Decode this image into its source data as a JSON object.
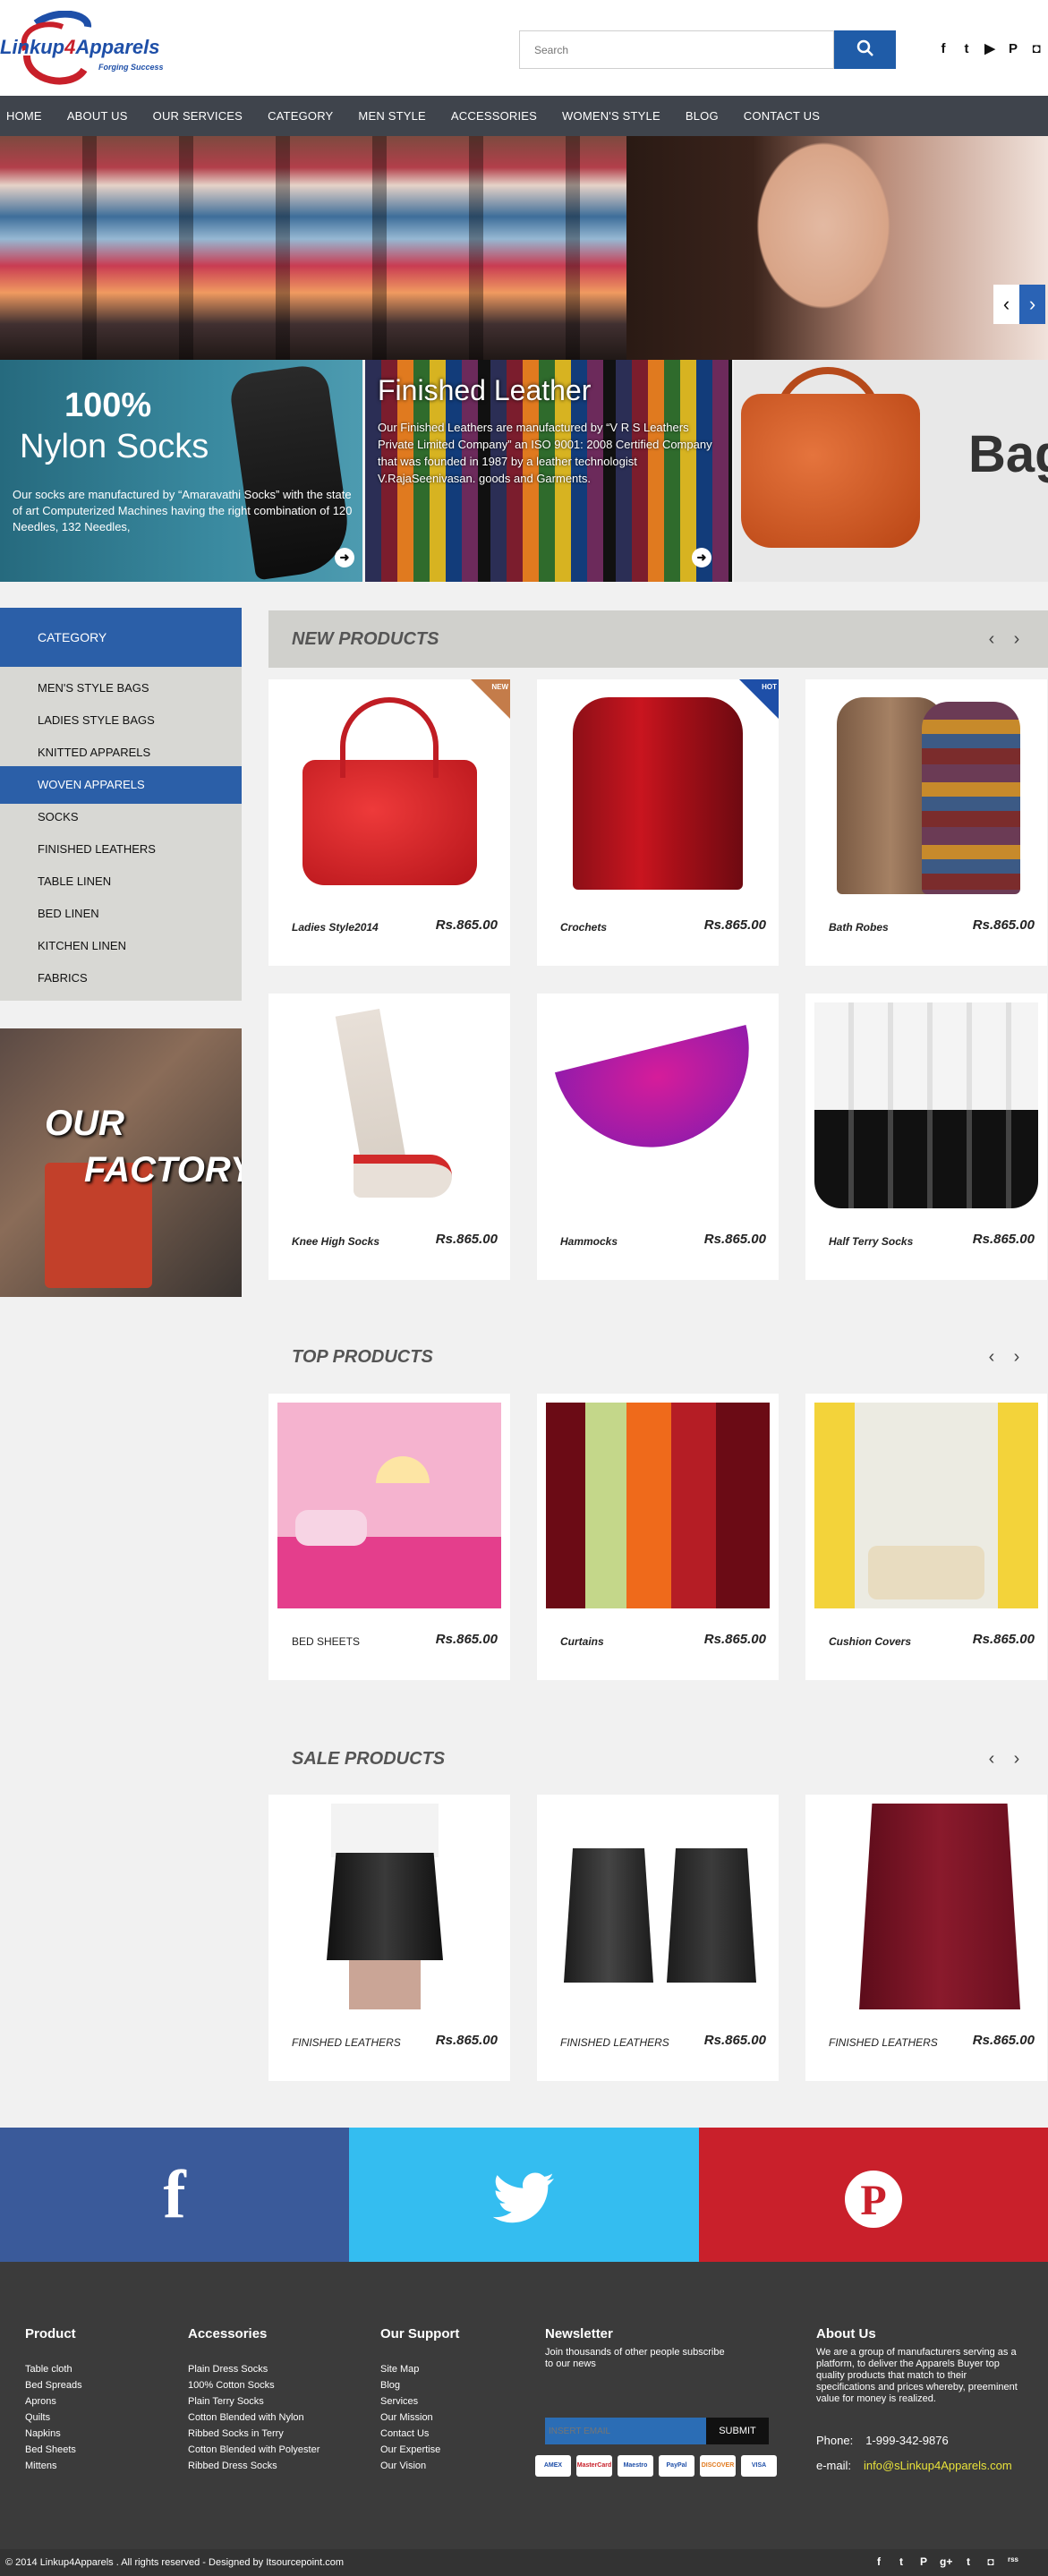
{
  "logo": {
    "name_part1": "Linkup",
    "name_part2": "4",
    "name_part3": "Apparels",
    "tagline": "Forging Success"
  },
  "search": {
    "placeholder": "Search"
  },
  "social_top": [
    {
      "icon": "facebook-icon",
      "glyph": "f"
    },
    {
      "icon": "twitter-icon",
      "glyph": "t"
    },
    {
      "icon": "youtube-icon",
      "glyph": "▶"
    },
    {
      "icon": "pinterest-icon",
      "glyph": "P"
    },
    {
      "icon": "instagram-icon",
      "glyph": "◘"
    }
  ],
  "nav": [
    "HOME",
    "ABOUT US",
    "OUR SERVICES",
    "CATEGORY",
    "MEN STYLE",
    "ACCESSORIES",
    "WOMEN'S STYLE",
    "BLOG",
    "CONTACT US"
  ],
  "hero": {
    "prev_icon": "‹",
    "next_icon": "›"
  },
  "promos": {
    "socks": {
      "big": "100%",
      "title": "Nylon Socks",
      "desc": "Our socks are manufactured by “Amaravathi Socks” with the state of art Computerized Machines having the right combination of 120 Needles, 132 Needles,"
    },
    "leather": {
      "title": "Finished Leather",
      "desc": "Our Finished Leathers are manufactured by “V R S Leathers Private Limited Company” an ISO 9001: 2008 Certified Company that was founded in 1987 by a leather technologist V.RajaSeenivasan. goods and Garments."
    },
    "bags": {
      "title": "Bag"
    }
  },
  "sidebar": {
    "category_header": "CATEGORY",
    "items": [
      "MEN'S STYLE BAGS",
      "LADIES STYLE BAGS",
      "KNITTED APPARELS",
      "WOVEN APPARELS",
      "SOCKS",
      "FINISHED LEATHERS",
      "TABLE LINEN",
      "BED LINEN",
      "KITCHEN LINEN",
      "FABRICS"
    ],
    "active_item": "WOVEN APPARELS",
    "factory_line1": "OUR",
    "factory_line2": "FACTORY"
  },
  "new_products": {
    "title": "NEW PRODUCTS",
    "items": [
      {
        "name": "Ladies Style2014",
        "price": "Rs.865.00",
        "badge": "NEW"
      },
      {
        "name": "Crochets",
        "price": "Rs.865.00",
        "badge": "HOT"
      },
      {
        "name": "Bath Robes",
        "price": "Rs.865.00",
        "badge": ""
      },
      {
        "name": "Knee High Socks",
        "price": "Rs.865.00",
        "badge": ""
      },
      {
        "name": "Hammocks",
        "price": "Rs.865.00",
        "badge": ""
      },
      {
        "name": "Half Terry Socks",
        "price": "Rs.865.00",
        "badge": ""
      }
    ]
  },
  "top_products": {
    "title": "TOP PRODUCTS",
    "items": [
      {
        "name": "BED SHEETS",
        "price": "Rs.865.00"
      },
      {
        "name": "Curtains",
        "price": "Rs.865.00"
      },
      {
        "name": "Cushion Covers",
        "price": "Rs.865.00"
      }
    ]
  },
  "sale_products": {
    "title": "SALE PRODUCTS",
    "items": [
      {
        "name": "FINISHED LEATHERS",
        "price": "Rs.865.00"
      },
      {
        "name": "FINISHED LEATHERS",
        "price": "Rs.865.00"
      },
      {
        "name": "FINISHED LEATHERS",
        "price": "Rs.865.00"
      }
    ]
  },
  "social_band": {
    "facebook": "f",
    "twitter": "🐦",
    "pinterest": "P"
  },
  "footer": {
    "product": {
      "title": "Product",
      "items": [
        "Table cloth",
        "Bed Spreads",
        "Aprons",
        "Quilts",
        "Napkins",
        "Bed Sheets",
        "Mittens"
      ]
    },
    "accessories": {
      "title": "Accessories",
      "items": [
        "Plain Dress Socks",
        "100% Cotton Socks",
        "Plain Terry Socks",
        "Cotton Blended with Nylon",
        "Ribbed Socks in Terry",
        "Cotton Blended with Polyester",
        "Ribbed Dress Socks"
      ]
    },
    "support": {
      "title": "Our Support",
      "items": [
        "Site Map",
        "Blog",
        "Services",
        "Our Mission",
        "Contact Us",
        "Our Expertise",
        "Our Vision"
      ]
    },
    "newsletter": {
      "title": "Newsletter",
      "desc": "Join thousands of other people subscribe to our news",
      "input_placeholder": "INSERT EMAIL",
      "submit": "SUBMIT"
    },
    "payments": [
      "AMEX",
      "MasterCard",
      "Maestro",
      "PayPal",
      "DISCOVER",
      "VISA"
    ],
    "about": {
      "title": "About Us",
      "desc": "We are a group of manufacturers serving as a platform, to deliver the Apparels Buyer top quality products that match to their specifications and prices whereby, preeminent value for money is realized.",
      "phone_label": "Phone:",
      "phone": "1-999-342-9876",
      "email_label": "e-mail:",
      "email": "info@sLinkup4Apparels.com"
    }
  },
  "bottom": {
    "copyright": "© 2014  Linkup4Apparels . All rights reserved - Designed by Itsourcepoint.com",
    "social": [
      "f",
      "t",
      "P",
      "g+",
      "t",
      "◘",
      "rss"
    ]
  },
  "colors": {
    "brand_blue": "#2b5fa8",
    "nav_bg": "#3f444c",
    "facebook": "#3a5a9a",
    "twitter": "#34bdf0",
    "pinterest": "#c9202b",
    "footer_bg": "#3b3b3b"
  }
}
